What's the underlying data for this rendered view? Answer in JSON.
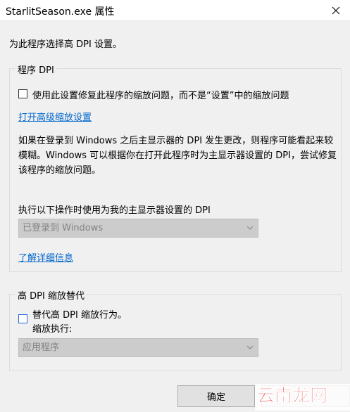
{
  "window": {
    "title": "StarlitSeason.exe 属性"
  },
  "intro": "为此程序选择高 DPI 设置。",
  "program_dpi": {
    "legend": "程序 DPI",
    "override_checkbox_label": "使用此设置修复此程序的缩放问题，而不是“设置”中的缩放问题",
    "advanced_link": "打开高级缩放设置",
    "description": "如果在登录到 Windows 之后主显示器的 DPI 发生更改，则程序可能看起来较模糊。Windows 可以根据你在打开此程序时为主显示器设置的 DPI，尝试修复该程序的缩放问题。",
    "select_label": "执行以下操作时使用为我的主显示器设置的 DPI",
    "select_value": "已登录到 Windows",
    "learn_more_link": "了解详细信息"
  },
  "dpi_override": {
    "legend": "高 DPI 缩放替代",
    "checkbox_label": "替代高 DPI 缩放行为。",
    "scaling_label": "缩放执行:",
    "select_value": "应用程序"
  },
  "buttons": {
    "ok": "确定"
  },
  "watermark": {
    "text": "云南龙网"
  },
  "colors": {
    "link": "#0066cc",
    "checkbox_focus": "#1e6bd6",
    "disabled_select": "#cccccc",
    "disabled_text": "#838383",
    "watermark_red": "#e8262a"
  }
}
